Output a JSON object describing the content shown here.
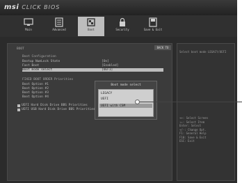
{
  "brand": {
    "logo": "msi",
    "subtitle": "CLICK BIOS"
  },
  "tabs": [
    {
      "label": "Main",
      "icon": "monitor-icon",
      "active": false
    },
    {
      "label": "Advanced",
      "icon": "advanced-icon",
      "active": false
    },
    {
      "label": "Boot",
      "icon": "boot-icon",
      "active": true
    },
    {
      "label": "Security",
      "icon": "lock-icon",
      "active": false
    },
    {
      "label": "Save & Exit",
      "icon": "save-exit-icon",
      "active": false
    }
  ],
  "main": {
    "section": "BOOT",
    "back_label": "BACK TO",
    "config_header": "Boot Configuration",
    "rows": [
      {
        "label": "Bootup NumLock State",
        "value": "[On]"
      },
      {
        "label": "Fast Boot",
        "value": "[Enabled]"
      },
      {
        "label": "Boot mode select",
        "value": "[UEFI]"
      }
    ],
    "priorities_header": "FIXED BOOT ORDER Priorities",
    "boot_options": [
      "Boot Option #1",
      "Boot Option #2",
      "Boot Option #3",
      "Boot Option #4"
    ],
    "bbs": [
      "UEFI Hard Disk Drive BBS Priorities",
      "UEFI USB Hard Disk Drive BBS Priorities"
    ]
  },
  "popup": {
    "title": "Boot mode select",
    "options": [
      "LEGACY",
      "UEFI",
      "LEGACY+UEFI",
      "UEFI with CSM"
    ],
    "selected": "UEFI with CSM"
  },
  "side": {
    "title": "Select boot mode LEGACY/UEFI",
    "help": [
      "++: Select Screen",
      "↑↓: Select Item",
      "Enter: Select",
      "+/-: Change Opt.",
      "F1: General Help",
      "F10: Save & Exit",
      "ESC: Exit"
    ]
  }
}
